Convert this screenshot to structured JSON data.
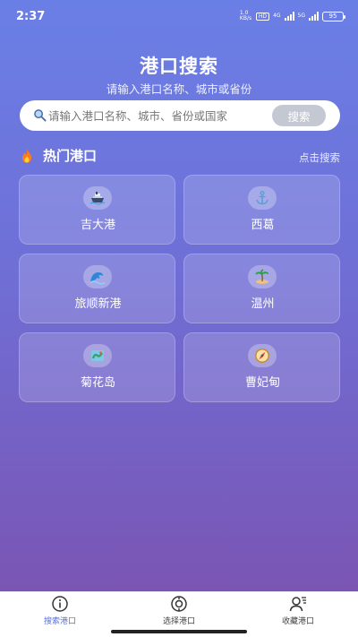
{
  "status": {
    "time": "2:37",
    "battery": "95",
    "hd": "HD",
    "speed": "1.0 KB/s",
    "net": "4G",
    "net2": "5G"
  },
  "header": {
    "title": "港口搜索",
    "subtitle": "请输入港口名称、城市或省份"
  },
  "search": {
    "placeholder": "请输入港口名称、城市、省份或国家",
    "button_label": "搜索"
  },
  "section": {
    "title": "热门港口",
    "link": "点击搜索"
  },
  "ports": [
    {
      "label": "吉大港",
      "icon": "ship-icon"
    },
    {
      "label": "西葛",
      "icon": "anchor-icon"
    },
    {
      "label": "旅顺新港",
      "icon": "wave-icon"
    },
    {
      "label": "温州",
      "icon": "island-icon"
    },
    {
      "label": "菊花岛",
      "icon": "map-icon"
    },
    {
      "label": "曹妃甸",
      "icon": "compass-icon"
    }
  ],
  "tabs": [
    {
      "label": "搜索港口",
      "icon": "info-icon",
      "active": true
    },
    {
      "label": "选择港口",
      "icon": "target-icon",
      "active": false
    },
    {
      "label": "收藏港口",
      "icon": "user-list-icon",
      "active": false
    }
  ],
  "colors": {
    "accent": "#5a6fd8",
    "gradient_top": "#6a7fe6",
    "gradient_bottom": "#7a55b4"
  }
}
